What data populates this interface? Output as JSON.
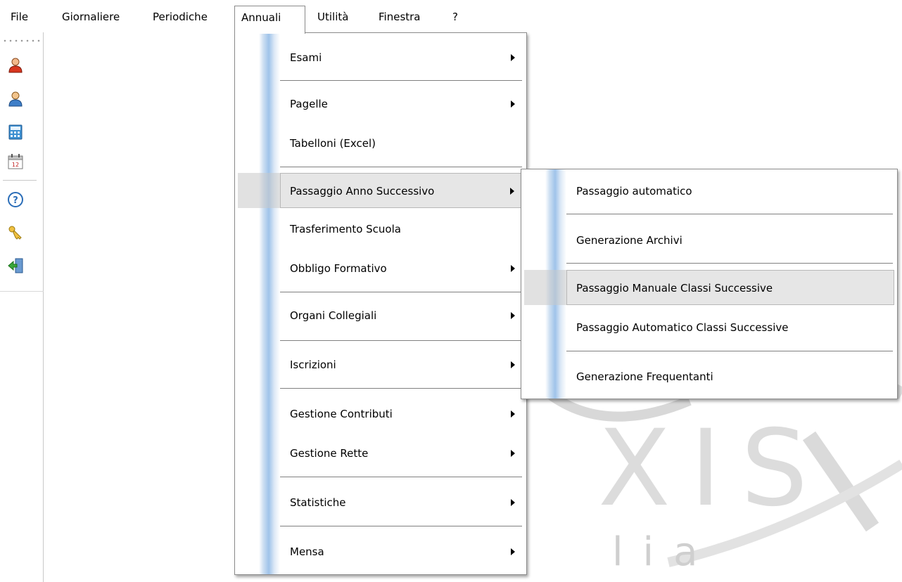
{
  "menubar": {
    "items": [
      {
        "label": "File"
      },
      {
        "label": "Giornaliere"
      },
      {
        "label": "Periodiche"
      },
      {
        "label": "Annuali"
      },
      {
        "label": "Utilità"
      },
      {
        "label": "Finestra"
      },
      {
        "label": "?"
      }
    ]
  },
  "toolbar": {
    "icons": [
      "user-red-icon",
      "user-blue-icon",
      "calculator-icon",
      "calendar-icon",
      "help-icon",
      "keys-icon",
      "exit-icon"
    ],
    "calendar_number": "12"
  },
  "annuali_menu": {
    "items": [
      {
        "label": "Esami"
      },
      {
        "label": "Pagelle"
      },
      {
        "label": "Tabelloni (Excel)"
      },
      {
        "label": "Passaggio Anno Successivo"
      },
      {
        "label": "Trasferimento Scuola"
      },
      {
        "label": "Obbligo Formativo"
      },
      {
        "label": "Organi Collegiali"
      },
      {
        "label": "Iscrizioni"
      },
      {
        "label": "Gestione Contributi"
      },
      {
        "label": "Gestione Rette"
      },
      {
        "label": "Statistiche"
      },
      {
        "label": "Mensa"
      }
    ]
  },
  "passaggio_submenu": {
    "items": [
      {
        "label": "Passaggio automatico"
      },
      {
        "label": "Generazione Archivi"
      },
      {
        "label": "Passaggio Manuale Classi Successive"
      },
      {
        "label": "Passaggio Automatico Classi Successive"
      },
      {
        "label": "Generazione Frequentanti"
      }
    ]
  },
  "watermark": {
    "letters": "XIS",
    "small": "lia"
  },
  "colors": {
    "menu_highlight": "#e6e6e6",
    "side_gradient": "#9fc3ea"
  }
}
